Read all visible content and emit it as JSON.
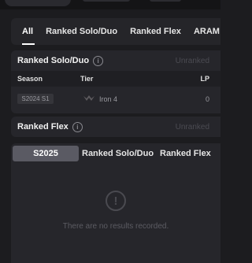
{
  "mode_tabs": [
    "All",
    "Ranked Solo/Duo",
    "Ranked Flex",
    "ARAM"
  ],
  "solo_card": {
    "title": "Ranked Solo/Duo",
    "info_icon": "i",
    "status": "Unranked",
    "columns": {
      "season": "Season",
      "tier": "Tier",
      "lp": "LP"
    },
    "row": {
      "season": "S2024 S1",
      "tier": "Iron 4",
      "lp": "0"
    }
  },
  "flex_card": {
    "title": "Ranked Flex",
    "info_icon": "i",
    "status": "Unranked"
  },
  "history_card": {
    "season_tab": "S2025",
    "tabs": [
      "Ranked Solo/Duo",
      "Ranked Flex"
    ],
    "empty_icon": "!",
    "empty_text": "There are no results recorded."
  }
}
